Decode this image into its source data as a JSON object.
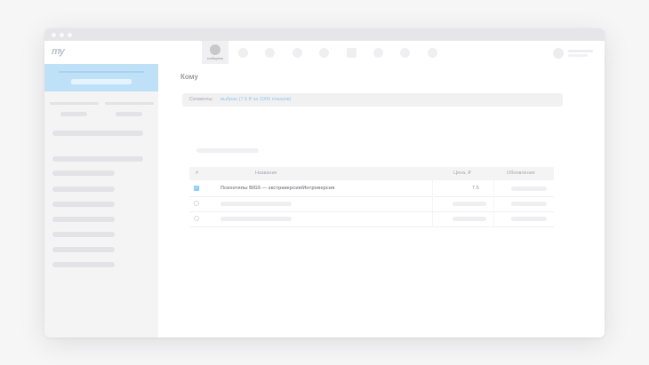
{
  "app": {
    "logo_text": "my",
    "nav_active_label": "сообщения"
  },
  "main": {
    "title": "Кому",
    "segments": {
      "label": "Сегменты:",
      "value": "выбран (7.5 ₽ за 1000 показов)"
    }
  },
  "table": {
    "headers": {
      "check": "#",
      "name": "Название",
      "price": "Цена, ₽",
      "updated": "Обновление"
    },
    "rows": [
      {
        "checked": true,
        "name": "Психотипы BIG5 — экстраверсия/Интроверсия",
        "price": "7.5"
      },
      {
        "checked": false,
        "name": "",
        "price": ""
      },
      {
        "checked": false,
        "name": "",
        "price": ""
      }
    ]
  },
  "colors": {
    "accent": "#8fcbf0",
    "sidebar_highlight": "#bfe1f7"
  },
  "icons": {
    "check": "✓"
  }
}
